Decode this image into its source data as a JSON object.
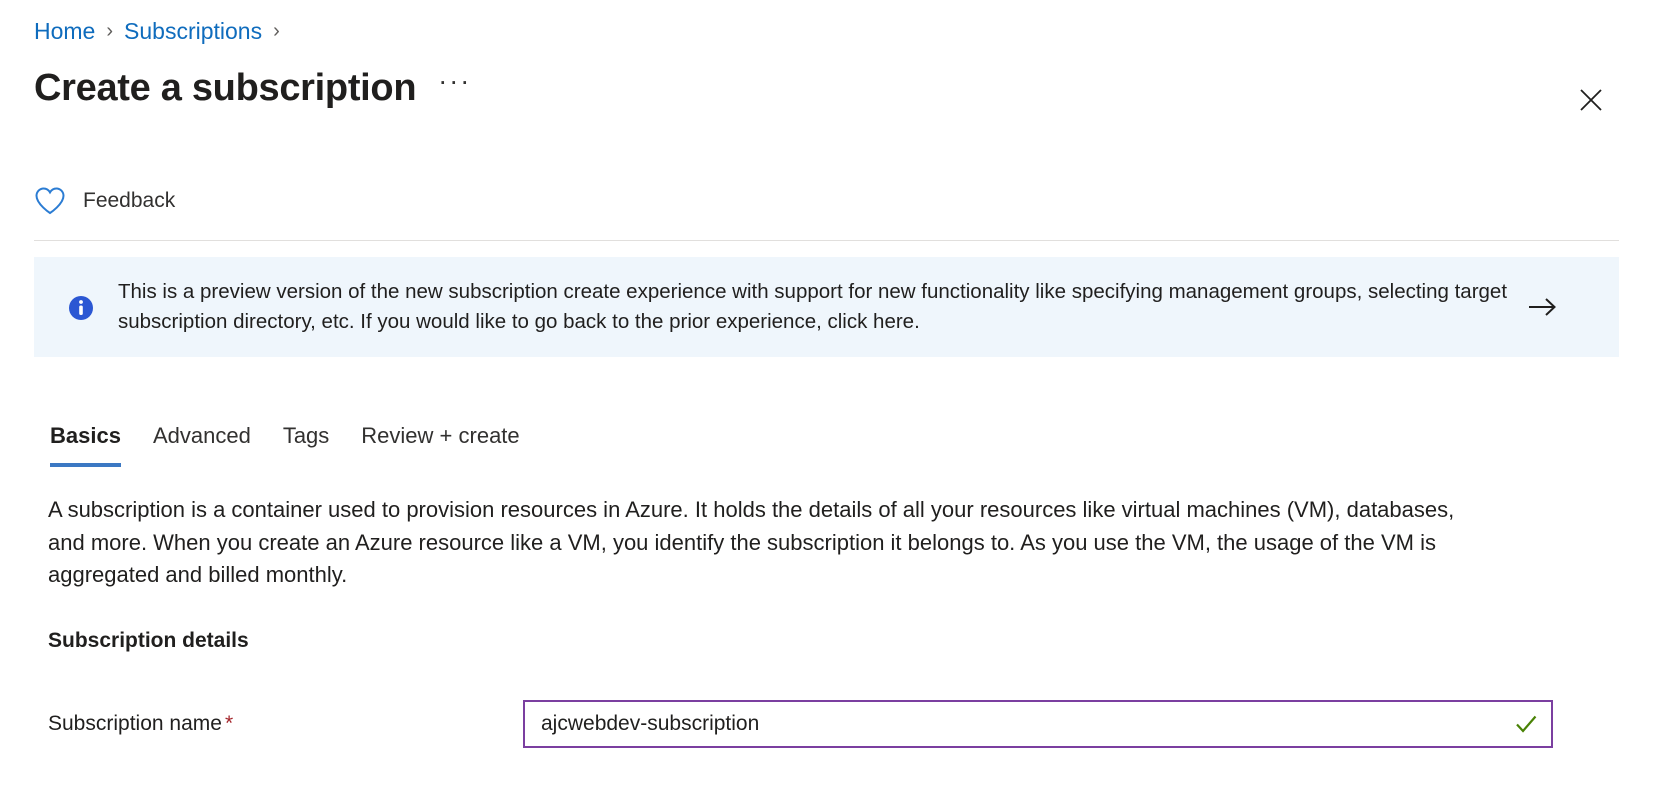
{
  "breadcrumb": {
    "items": [
      {
        "label": "Home"
      },
      {
        "label": "Subscriptions"
      }
    ],
    "separator": "›",
    "trailing_separator": "›"
  },
  "header": {
    "title": "Create a subscription",
    "ellipsis": "···",
    "close_icon": "close-icon"
  },
  "commandbar": {
    "feedback_label": "Feedback",
    "feedback_icon": "heart-icon"
  },
  "banner": {
    "icon": "info-icon",
    "text": "This is a preview version of the new subscription create experience with support for new functionality like specifying management groups, selecting target subscription directory, etc. If you would like to go back to the prior experience, click here.",
    "action_icon": "arrow-right-icon",
    "background_color": "#eff6fc",
    "icon_color": "#0f6cbd"
  },
  "tabs": {
    "items": [
      {
        "label": "Basics",
        "active": true
      },
      {
        "label": "Advanced",
        "active": false
      },
      {
        "label": "Tags",
        "active": false
      },
      {
        "label": "Review + create",
        "active": false
      }
    ],
    "active_underline_color": "#3b78c3"
  },
  "main": {
    "intro": "A subscription is a container used to provision resources in Azure. It holds the details of all your resources like virtual machines (VM), databases, and more. When you create an Azure resource like a VM, you identify the subscription it belongs to. As you use the VM, the usage of the VM is aggregated and billed monthly.",
    "section_heading": "Subscription details",
    "fields": {
      "subscription_name": {
        "label": "Subscription name",
        "required_marker": "*",
        "value": "ajcwebdev-subscription",
        "placeholder": "",
        "validation_icon": "check-icon",
        "validation_color": "#498205",
        "border_color": "#7b3fa0"
      }
    }
  },
  "colors": {
    "link": "#0f6cbd",
    "text": "#201f1e",
    "required": "#a4262c",
    "divider": "#e1dfdd"
  }
}
